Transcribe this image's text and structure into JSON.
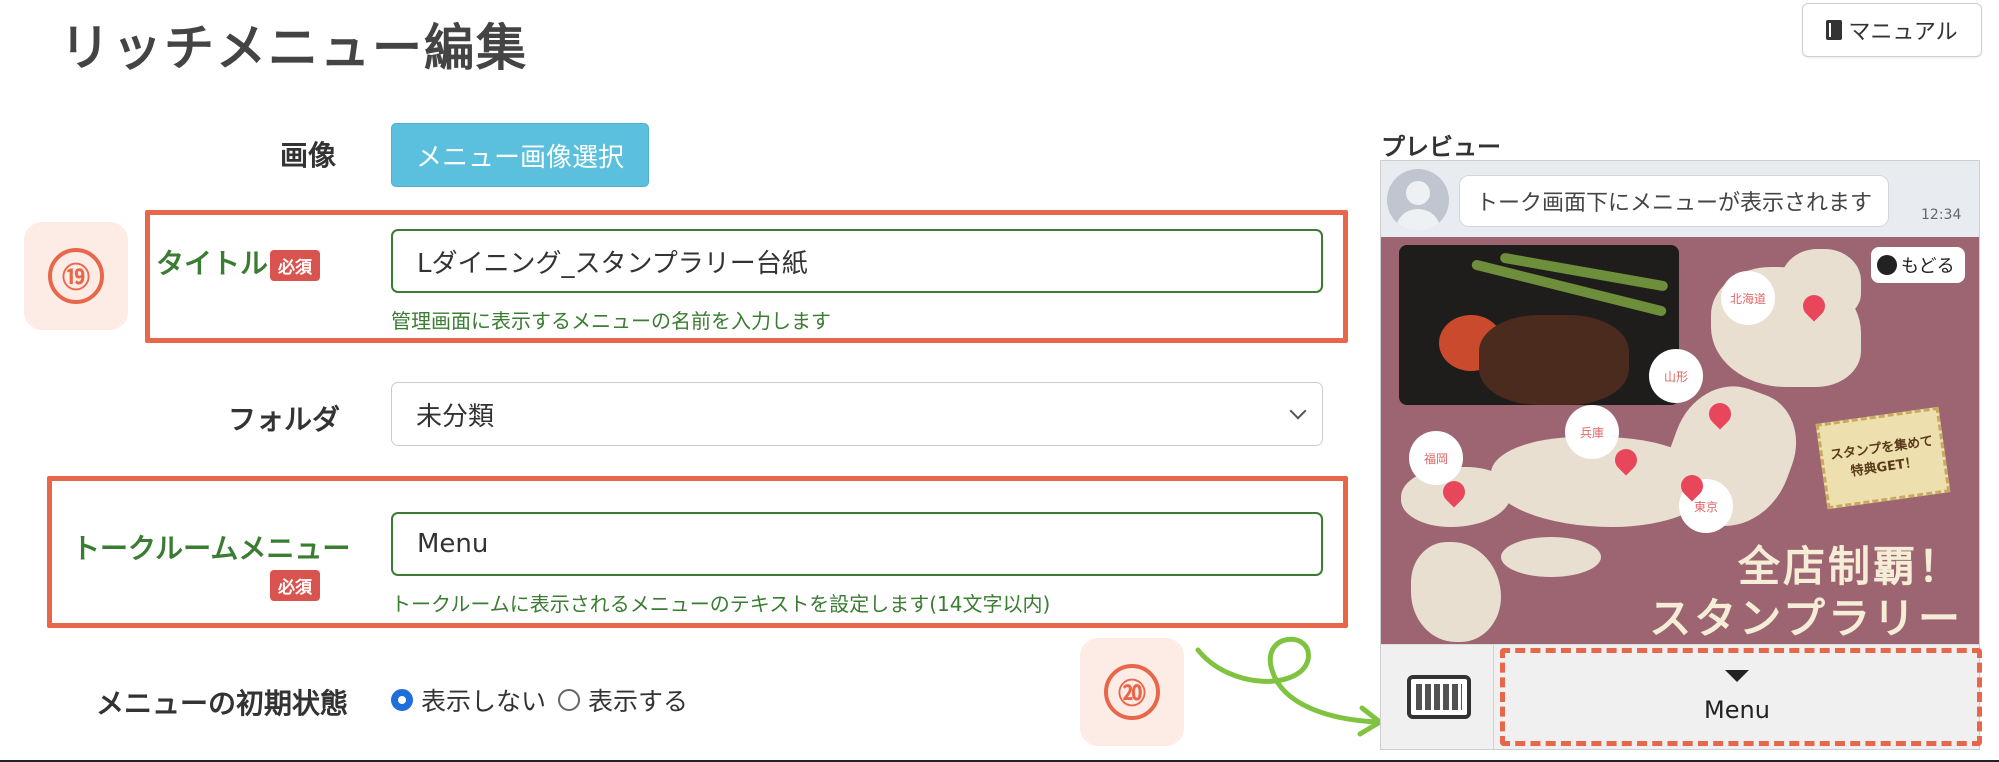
{
  "header": {
    "title": "リッチメニュー編集",
    "manual_label": "マニュアル"
  },
  "form": {
    "image_label": "画像",
    "image_button": "メニュー画像選択",
    "title_label": "タイトル",
    "required_badge": "必須",
    "title_value": "Lダイニング_スタンプラリー台紙",
    "title_help": "管理画面に表示するメニューの名前を入力します",
    "folder_label": "フォルダ",
    "folder_value": "未分類",
    "talkroom_label": "トークルームメニュー",
    "talkroom_value": "Menu",
    "talkroom_help": "トークルームに表示されるメニューのテキストを設定します(14文字以内)",
    "initial_state_label": "メニューの初期状態",
    "initial_state_options": [
      "表示しない",
      "表示する"
    ],
    "initial_state_selected": "表示しない"
  },
  "annotations": {
    "step_19": "⑲",
    "step_20": "⑳",
    "accent_color": "#e8674b"
  },
  "preview": {
    "title": "プレビュー",
    "bubble_text": "トーク画面下にメニューが表示されます",
    "time": "12:34",
    "back_button": "もどる",
    "prefectures": [
      "北海道",
      "山形",
      "兵庫",
      "福岡",
      "東京"
    ],
    "stamp_card_line1": "スタンプを集めて",
    "stamp_card_line2": "特典GET！",
    "headline_line1": "全店制覇！",
    "headline_line2": "スタンプラリー",
    "menu_toggle_label": "Menu",
    "keyboard_icon": "keyboard-icon"
  },
  "colors": {
    "primary_green": "#3a7d32",
    "info_blue": "#5bc0de",
    "required_red": "#d9534f",
    "radio_blue": "#1e6fd9"
  }
}
